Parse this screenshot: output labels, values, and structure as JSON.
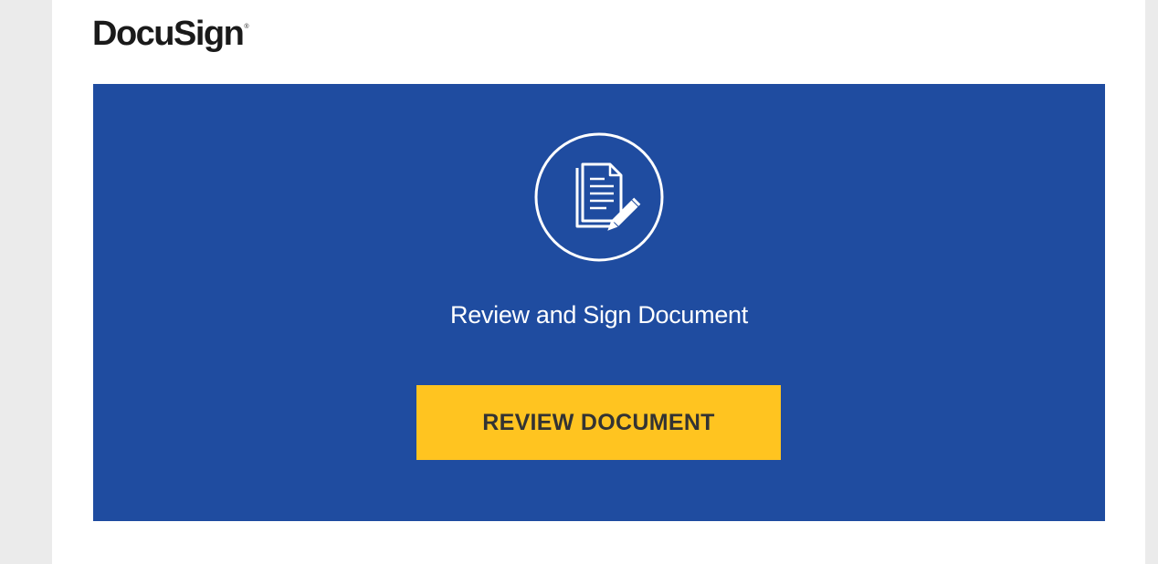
{
  "brand": {
    "logo_text": "DocuSign",
    "trademark": "®"
  },
  "hero": {
    "icon": "document-sign-icon",
    "title": "Review and Sign Document",
    "button_label": "REVIEW DOCUMENT"
  },
  "colors": {
    "hero_background": "#1f4ca0",
    "button_background": "#ffc420",
    "page_background": "#ebebeb"
  }
}
